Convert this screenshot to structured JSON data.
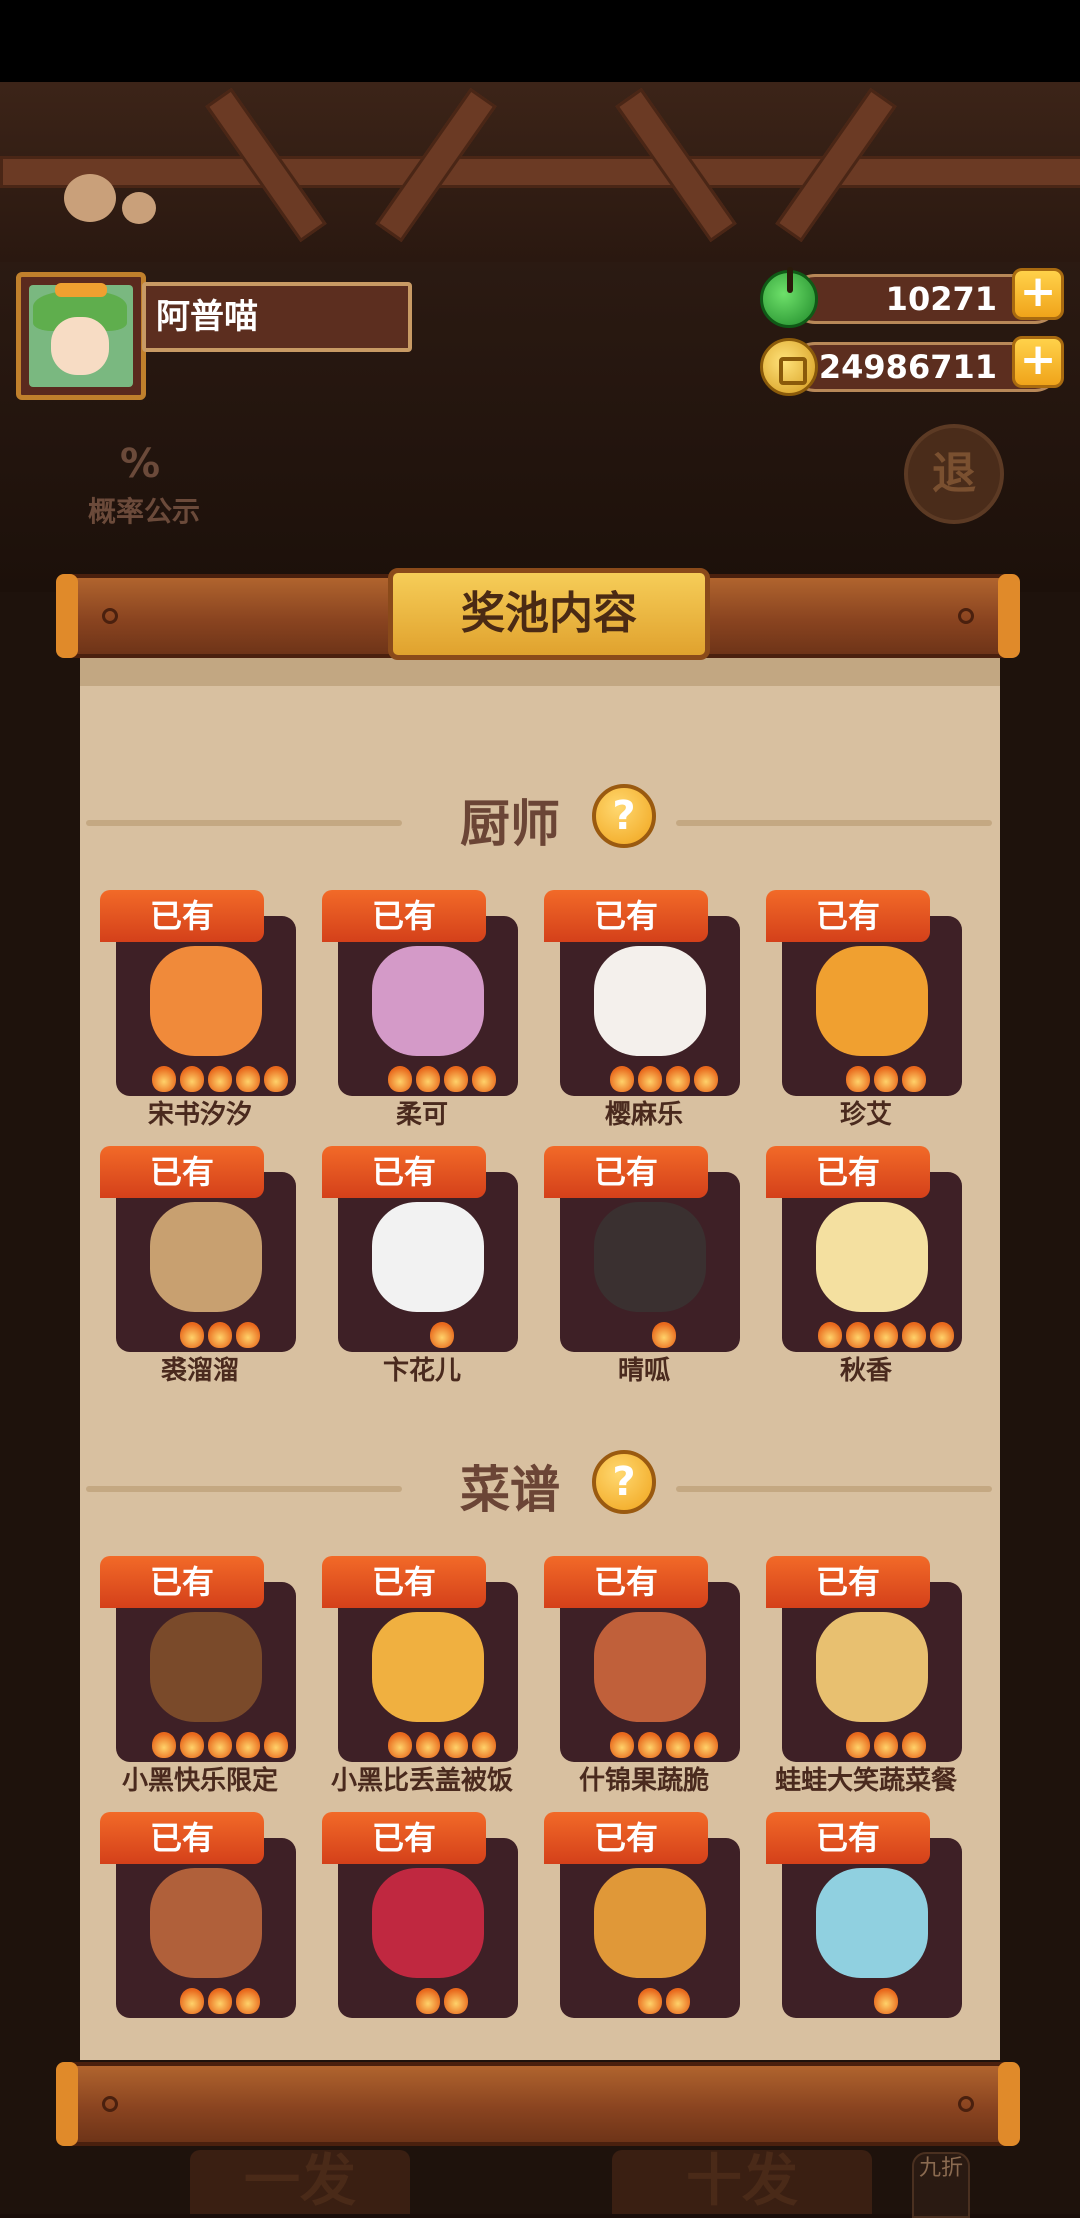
{
  "player": {
    "name": "阿普喵"
  },
  "currency": {
    "jade": "10271",
    "coins": "24986711",
    "add_symbol": "+"
  },
  "top_left": {
    "probability_icon": "%",
    "probability_label": "概率公示"
  },
  "exit_button": {
    "label": "退"
  },
  "popup": {
    "title": "奖池内容"
  },
  "chefs": {
    "title": "厨师",
    "help": "?",
    "items": [
      {
        "name": "宋书汐汐",
        "badge": "已有",
        "stars": 5
      },
      {
        "name": "柔可",
        "badge": "已有",
        "stars": 4
      },
      {
        "name": "樱麻乐",
        "badge": "已有",
        "stars": 4
      },
      {
        "name": "珍艾",
        "badge": "已有",
        "stars": 3
      },
      {
        "name": "裘溜溜",
        "badge": "已有",
        "stars": 3
      },
      {
        "name": "卞花儿",
        "badge": "已有",
        "stars": 1
      },
      {
        "name": "晴呱",
        "badge": "已有",
        "stars": 1
      },
      {
        "name": "秋香",
        "badge": "已有",
        "stars": 5
      }
    ]
  },
  "recipes": {
    "title": "菜谱",
    "help": "?",
    "items": [
      {
        "name": "小黑快乐限定",
        "badge": "已有",
        "stars": 5
      },
      {
        "name": "小黑比丢盖被饭",
        "badge": "已有",
        "stars": 4
      },
      {
        "name": "什锦果蔬脆",
        "badge": "已有",
        "stars": 4
      },
      {
        "name": "蛙蛙大笑蔬菜餐",
        "badge": "已有",
        "stars": 3
      },
      {
        "name": "",
        "badge": "已有",
        "stars": 3
      },
      {
        "name": "",
        "badge": "已有",
        "stars": 2
      },
      {
        "name": "",
        "badge": "已有",
        "stars": 2
      },
      {
        "name": "",
        "badge": "已有",
        "stars": 1
      }
    ]
  },
  "bottom": {
    "single_pull": "一发",
    "ten_pull": "十发",
    "discount": "九折"
  },
  "colors": {
    "badge": "#e0521e",
    "card": "#3e2026",
    "panel": "#d8c0a0",
    "rod": "#8a4420",
    "plate": "#f0b83e"
  }
}
